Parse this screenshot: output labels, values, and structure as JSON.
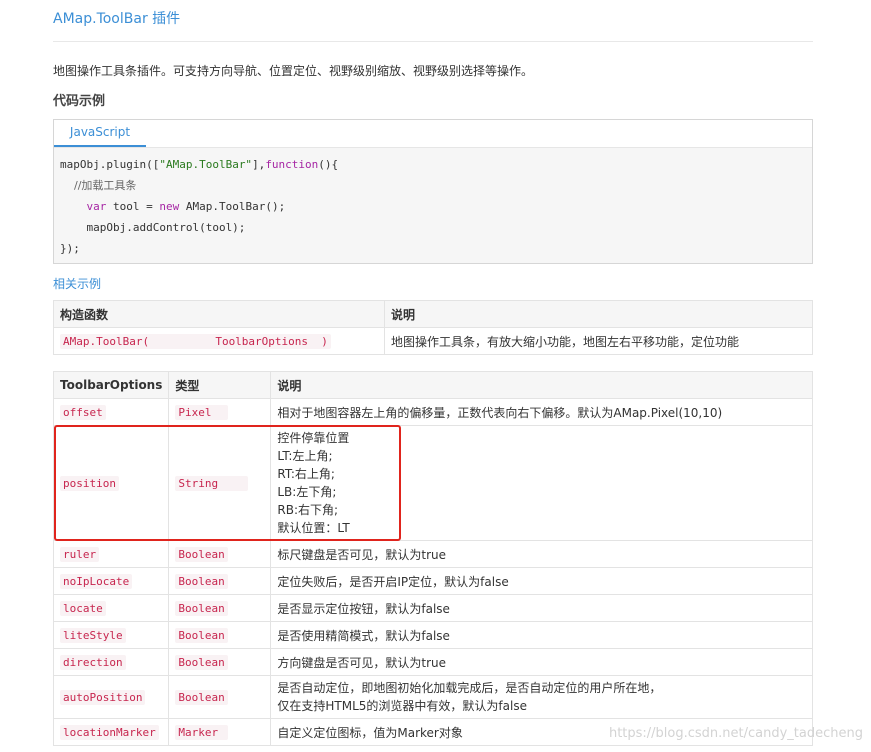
{
  "title": "AMap.ToolBar 插件",
  "description": "地图操作工具条插件。可支持方向导航、位置定位、视野级别缩放、视野级别选择等操作。",
  "code_heading": "代码示例",
  "code_tab": "JavaScript",
  "code": {
    "l1_a": "mapObj.plugin([",
    "l1_str": "\"AMap.ToolBar\"",
    "l1_b": "],",
    "l1_kw": "function",
    "l1_c": "(){",
    "l2": "    //加载工具条",
    "l3_kw": "var",
    "l3_a": " tool = ",
    "l3_kw2": "new",
    "l3_b": " AMap.ToolBar();",
    "l4": "    mapObj.addControl(tool);",
    "l5": "});"
  },
  "related_link": "相关示例",
  "ctor_table": {
    "headers": [
      "构造函数",
      "说明"
    ],
    "row": {
      "ctor": "AMap.ToolBar(          ToolbarOptions  )",
      "desc": "地图操作工具条，有放大缩小功能，地图左右平移功能，定位功能"
    }
  },
  "opt_table": {
    "headers": [
      "ToolbarOptions",
      "类型",
      "说明"
    ],
    "rows": [
      {
        "name": "offset",
        "type": "Pixel  ",
        "desc": "相对于地图容器左上角的偏移量，正数代表向右下偏移。默认为AMap.Pixel(10,10)"
      },
      {
        "name": "position",
        "type": "String    ",
        "desc_lines": [
          "控件停靠位置",
          "LT:左上角;",
          "RT:右上角;",
          "LB:左下角;",
          "RB:右下角;",
          "默认位置：LT"
        ]
      },
      {
        "name": "ruler",
        "type": "Boolean",
        "desc": "标尺键盘是否可见，默认为true"
      },
      {
        "name": "noIpLocate",
        "type": "Boolean",
        "desc": "定位失败后，是否开启IP定位，默认为false"
      },
      {
        "name": "locate",
        "type": "Boolean",
        "desc": "是否显示定位按钮，默认为false"
      },
      {
        "name": "liteStyle",
        "type": "Boolean",
        "desc": "是否使用精简模式，默认为false"
      },
      {
        "name": "direction",
        "type": "Boolean",
        "desc": "方向键盘是否可见，默认为true"
      },
      {
        "name": "autoPosition",
        "type": "Boolean",
        "desc_lines": [
          "是否自动定位，即地图初始化加载完成后，是否自动定位的用户所在地，",
          "仅在支持HTML5的浏览器中有效，默认为false"
        ]
      },
      {
        "name": "locationMarker",
        "type": "Marker ",
        "desc": "自定义定位图标，值为Marker对象"
      }
    ]
  },
  "watermark": "https://blog.csdn.net/candy_tadecheng",
  "colors": {
    "link": "#3c8fd6",
    "highlight_box": "#e0241d",
    "code_inline": "#c7254e"
  }
}
